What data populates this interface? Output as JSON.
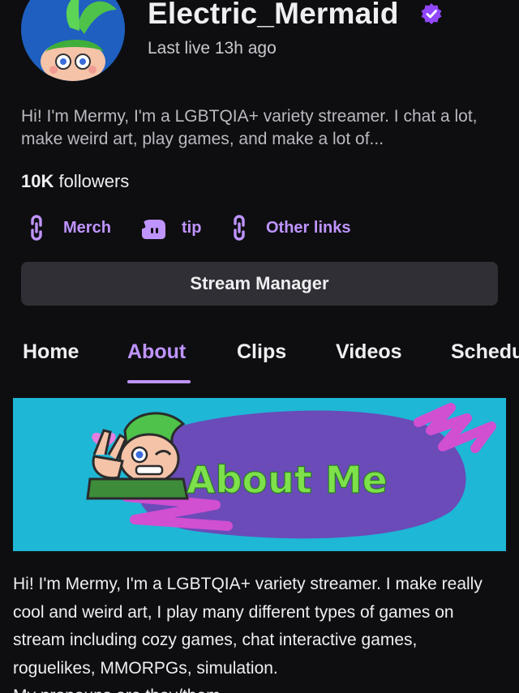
{
  "profile": {
    "channel_name": "Electric_Mermaid",
    "last_live": "Last live 13h ago",
    "bio_short": "Hi! I'm Mermy, I'm a LGBTQIA+ variety streamer. I chat a lot, make weird art, play games, and make a lot of...",
    "followers_count": "10K",
    "followers_label": "followers"
  },
  "links": [
    {
      "label": "Merch",
      "icon": "link-icon"
    },
    {
      "label": "tip",
      "icon": "streamlabs-icon"
    },
    {
      "label": "Other links",
      "icon": "link-icon"
    }
  ],
  "stream_manager_label": "Stream Manager",
  "tabs": [
    {
      "label": "Home"
    },
    {
      "label": "About"
    },
    {
      "label": "Clips"
    },
    {
      "label": "Videos"
    },
    {
      "label": "Schedule"
    }
  ],
  "active_tab": "About",
  "banner": {
    "text": "About Me"
  },
  "about": {
    "paragraph": "Hi! I'm Mermy, I'm a LGBTQIA+ variety streamer. I make really cool and weird art, I play many different types of games on stream including cozy games, chat interactive games, roguelikes, MMORPGs, simulation.",
    "pronouns": "My pronouns are they/them"
  },
  "colors": {
    "background": "#0e0e10",
    "accent": "#bf94ff",
    "verified": "#9147ff",
    "button_bg": "#2f2f35",
    "banner_bg": "#1eb7d6",
    "banner_blob": "#6a4bb8",
    "banner_text": "#7ee04a"
  }
}
